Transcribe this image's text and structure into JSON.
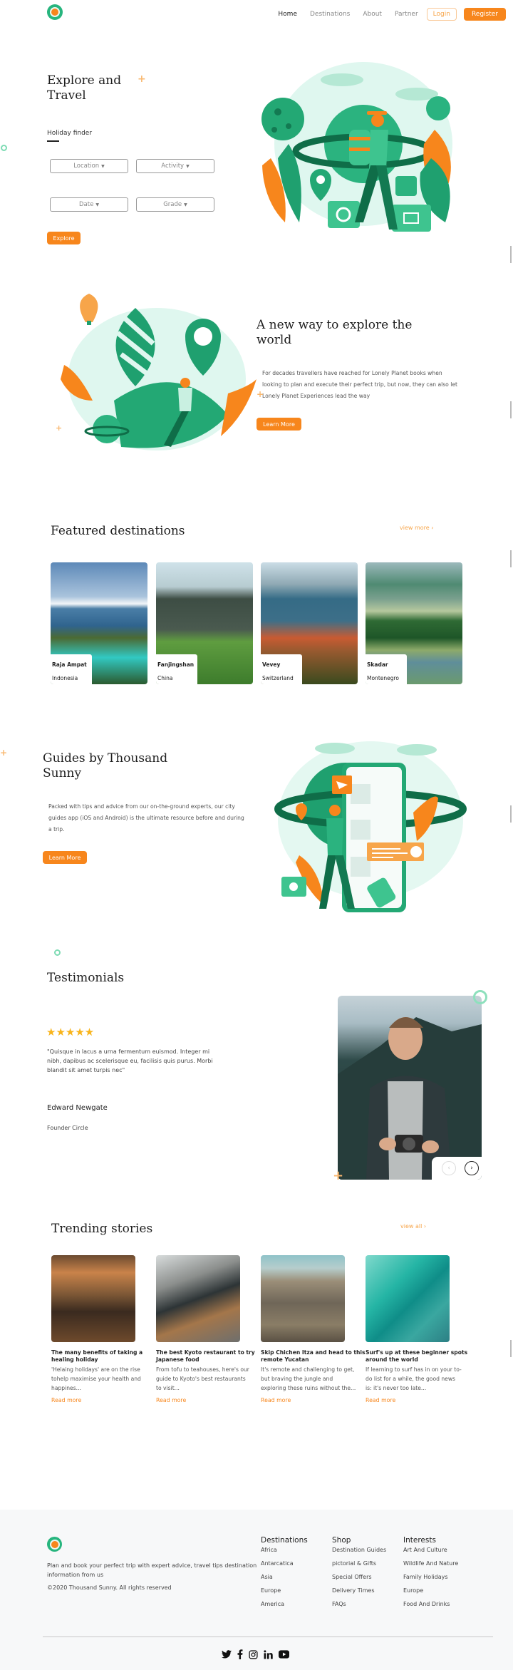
{
  "header": {
    "nav": [
      "Home",
      "Destinations",
      "About",
      "Partner"
    ],
    "login": "Login",
    "register": "Register"
  },
  "hero": {
    "title_line1": "Explore and",
    "title_line2": "Travel",
    "finder_label": "Holiday finder",
    "selects": [
      "Location",
      "Activity",
      "Date",
      "Grade"
    ],
    "explore_button": "Explore"
  },
  "explore": {
    "title_line1": "A new way to explore the",
    "title_line2": "world",
    "text_line1": "For decades travellers have reached for Lonely Planet books when",
    "text_line2": "looking to plan and execute their perfect trip, but now, they can also let",
    "text_line3": "Lonely Planet Experiences lead the way",
    "button": "Learn More"
  },
  "featured": {
    "title": "Featured destinations",
    "view_more": "view more",
    "cards": [
      {
        "name": "Raja Ampat",
        "country": "Indonesia"
      },
      {
        "name": "Fanjingshan",
        "country": "China"
      },
      {
        "name": "Vevey",
        "country": "Switzerland"
      },
      {
        "name": "Skadar",
        "country": "Montenegro"
      }
    ]
  },
  "guides": {
    "title_line1": "Guides by Thousand",
    "title_line2": "Sunny",
    "text_line1": "Packed with tips and advice from our on-the-ground experts, our city",
    "text_line2": "guides app (iOS and Android) is the ultimate resource before and during",
    "text_line3": "a trip.",
    "button": "Learn More"
  },
  "testimonials": {
    "title": "Testimonials",
    "rating": 5,
    "stars": "★★★★★",
    "quote_line1": "\"Quisque in lacus a urna fermentum euismod. Integer mi",
    "quote_line2": "nibh, dapibus ac scelerisque eu, facilisis quis purus. Morbi",
    "quote_line3": "blandit sit amet turpis nec\"",
    "name": "Edward Newgate",
    "role": "Founder Circle",
    "prev": "‹",
    "next": "›"
  },
  "trending": {
    "title": "Trending stories",
    "view_all": "view all",
    "read_more": "Read more",
    "stories": [
      {
        "title1": "The many benefits of taking a",
        "title2": "healing holiday",
        "t1": "'Helaing holidays' are on the rise",
        "t2": "tohelp maximise your health and",
        "t3": "happines..."
      },
      {
        "title1": "The best Kyoto restaurant to try",
        "title2": "Japanese food",
        "t1": "From tofu to teahouses, here's our",
        "t2": "guide to Kyoto's best restaurants",
        "t3": "to visit..."
      },
      {
        "title1": "Skip Chichen Itza and head to this",
        "title2": "remote Yucatan",
        "t1": "It's remote and challenging to get,",
        "t2": "but braving the jungle and",
        "t3": "exploring these ruins without the..."
      },
      {
        "title1": "Surf's up at these beginner spots",
        "title2": "around the world",
        "t1": "If learning to surf has in on your to-",
        "t2": "do list for a while, the good news",
        "t3": "is: it's never too late..."
      }
    ]
  },
  "footer": {
    "tagline_line1": "Plan and book your perfect trip with expert advice, travel tips destination",
    "tagline_line2": "information from us",
    "copyright": "©2020 Thousand Sunny. All rights reserved",
    "columns": [
      {
        "title": "Destinations",
        "items": [
          "Africa",
          "Antarcatica",
          "Asia",
          "Europe",
          "America"
        ]
      },
      {
        "title": "Shop",
        "items": [
          "Destination Guides",
          "pictorial & Gifts",
          "Special Offers",
          "Delivery Times",
          "FAQs"
        ]
      },
      {
        "title": "Interests",
        "items": [
          "Art And Culture",
          "Wildlife And Nature",
          "Family Holidays",
          "Europe",
          "Food And Drinks"
        ]
      }
    ],
    "social": [
      "twitter-icon",
      "facebook-icon",
      "instagram-icon",
      "linkedin-icon",
      "youtube-icon"
    ]
  },
  "colors": {
    "accent": "#f7861c",
    "brand_green": "#27b57e",
    "star": "#f8b41b"
  }
}
